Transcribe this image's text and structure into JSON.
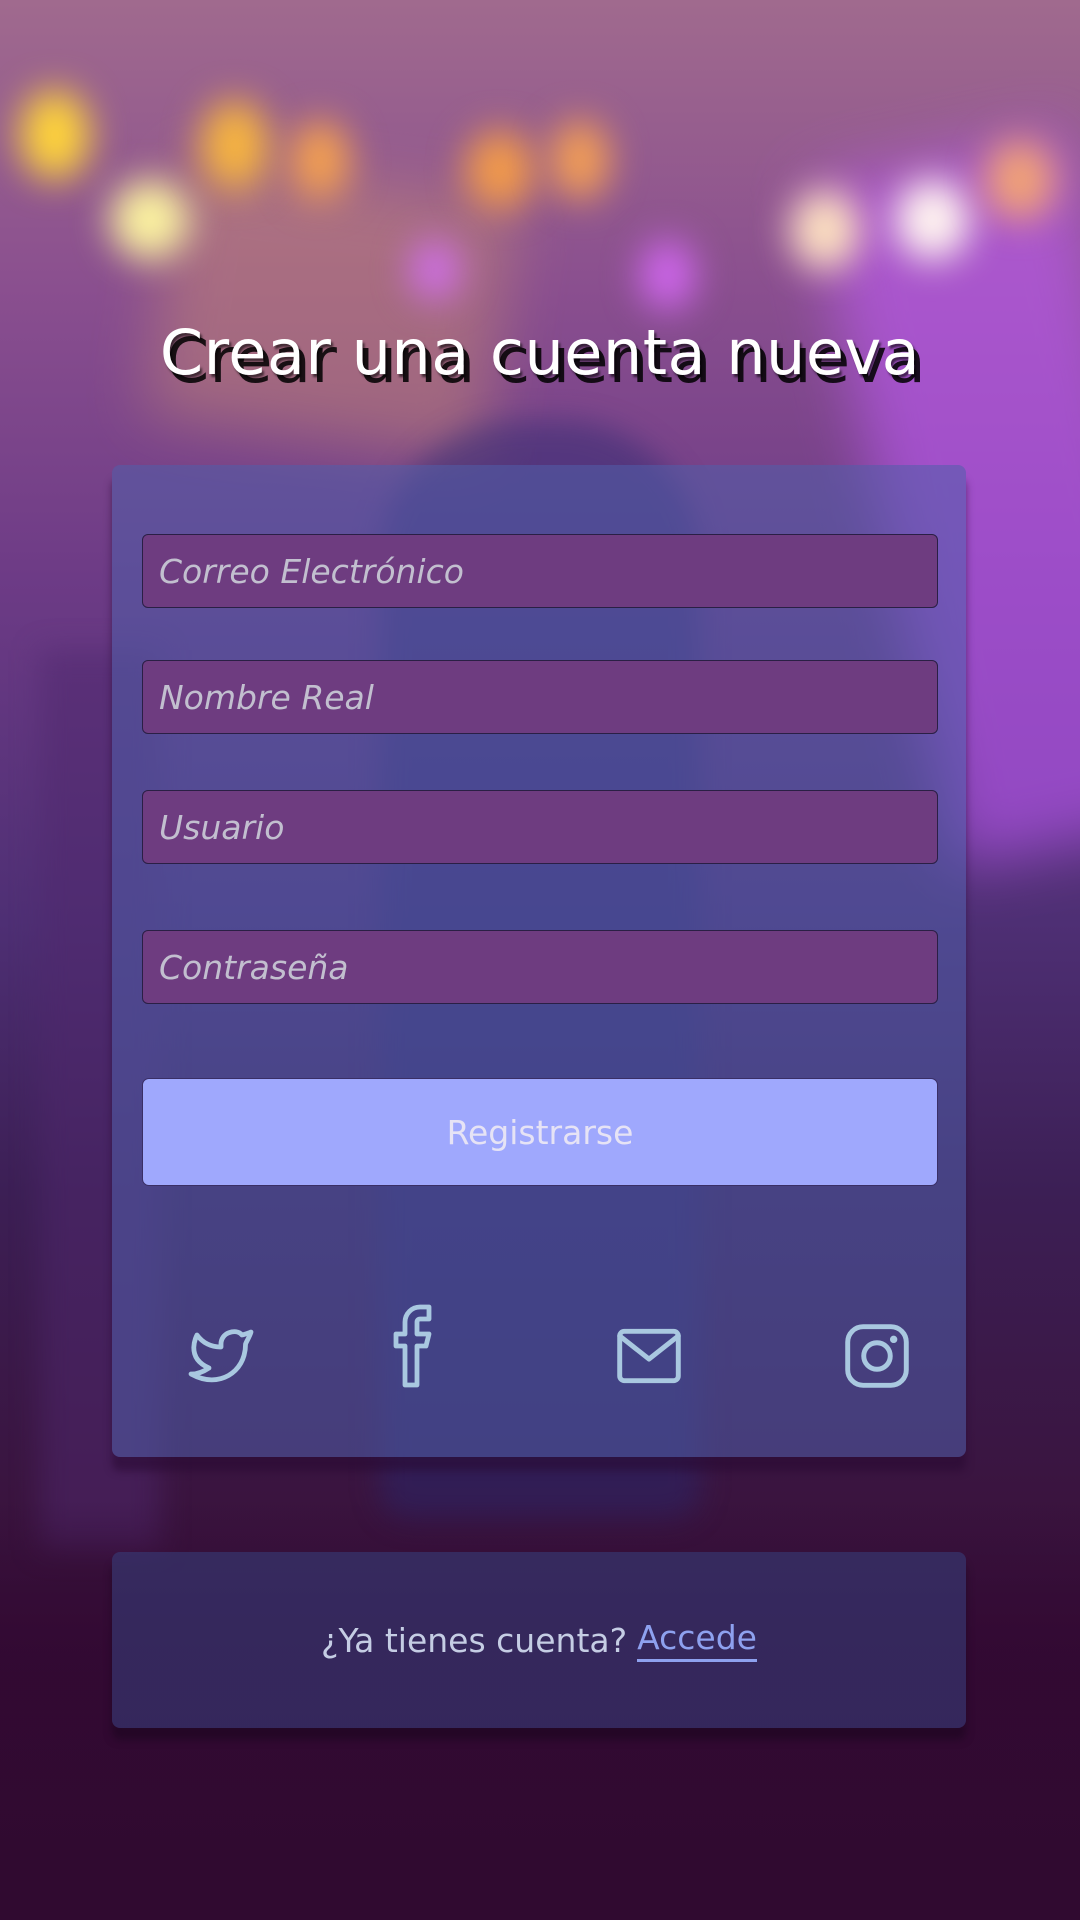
{
  "page": {
    "title": "Crear una cuenta nueva"
  },
  "form": {
    "email_placeholder": "Correo Electrónico",
    "name_placeholder": "Nombre Real",
    "username_placeholder": "Usuario",
    "password_placeholder": "Contraseña",
    "submit_label": "Registrarse"
  },
  "social": {
    "icons": [
      "twitter-icon",
      "facebook-icon",
      "mail-icon",
      "instagram-icon"
    ],
    "icon_color": "#a9c8e0"
  },
  "login": {
    "prompt": "¿Ya tienes cuenta?",
    "link_label": "Accede"
  },
  "colors": {
    "field_bg": "#6e3c80",
    "button_bg": "#9fa8fd",
    "link": "#8ea1ef"
  }
}
